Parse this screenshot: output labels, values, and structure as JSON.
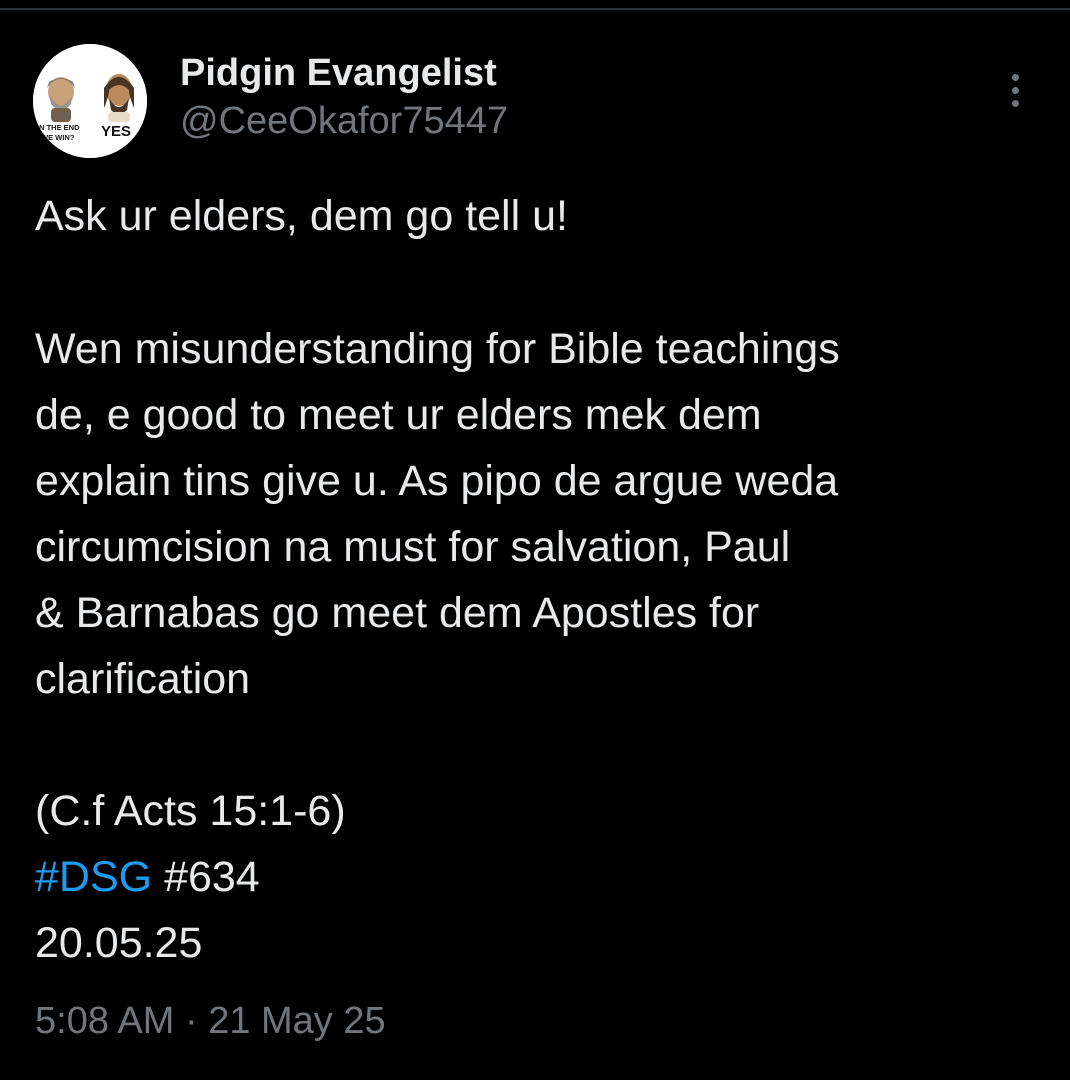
{
  "author": {
    "display_name": "Pidgin Evangelist",
    "handle": "@CeeOkafor75447",
    "avatar": {
      "left_caption_line1": "IN THE END",
      "left_caption_line2": "WE WIN?",
      "right_caption": "YES"
    }
  },
  "tweet": {
    "headline": "Ask ur elders, dem go tell u!",
    "paragraph_lines": [
      "Wen misunderstanding for Bible teachings",
      "de, e good to meet ur elders mek dem",
      "explain tins give u. As pipo de argue weda",
      "circumcision na must for salvation, Paul",
      "& Barnabas go meet dem Apostles for",
      "clarification"
    ],
    "reference": "(C.f Acts 15:1-6)",
    "hashtag": "#DSG",
    "number_tag": "#634",
    "date_line": "20.05.25",
    "timestamp": "5:08 AM · 21 May 25"
  },
  "icons": {
    "more": "more-options-icon"
  },
  "colors": {
    "background": "#000000",
    "text": "#e7e9ea",
    "secondary": "#71767b",
    "link": "#1d9bf0"
  }
}
